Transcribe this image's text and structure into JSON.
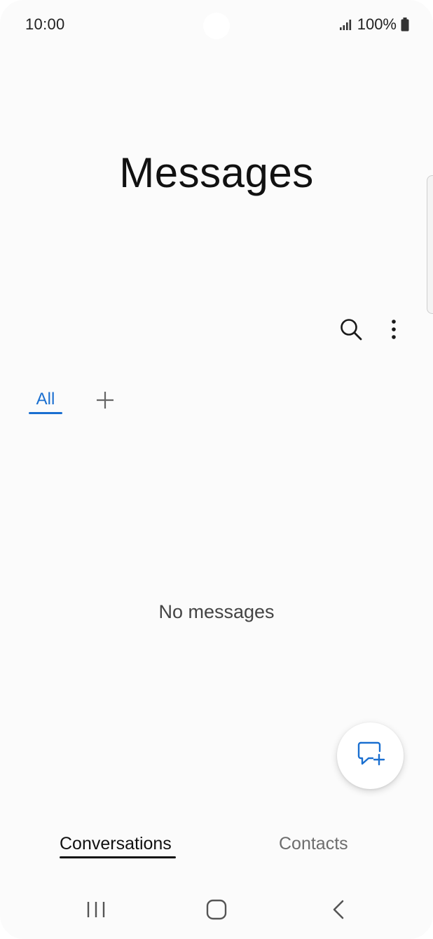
{
  "status_bar": {
    "time": "10:00",
    "battery_text": "100%",
    "icons": [
      "signal-icon",
      "battery-icon"
    ]
  },
  "header": {
    "title": "Messages"
  },
  "toolbar": {
    "icons": [
      "search-icon",
      "more-options-icon"
    ]
  },
  "tabs": {
    "items": [
      {
        "label": "All",
        "selected": true
      }
    ],
    "add_icon": "add-icon"
  },
  "empty_state": {
    "text": "No messages"
  },
  "fab": {
    "icon": "new-message-icon"
  },
  "bottom_tabs": {
    "items": [
      {
        "label": "Conversations",
        "selected": true
      },
      {
        "label": "Contacts",
        "selected": false
      }
    ]
  },
  "nav_bar": {
    "icons": [
      "recent-apps-icon",
      "home-icon",
      "back-icon"
    ]
  },
  "colors": {
    "accent": "#1a6fd0",
    "background": "#fbfbfb",
    "text_primary": "#111111",
    "text_secondary": "#6d6d6d"
  }
}
